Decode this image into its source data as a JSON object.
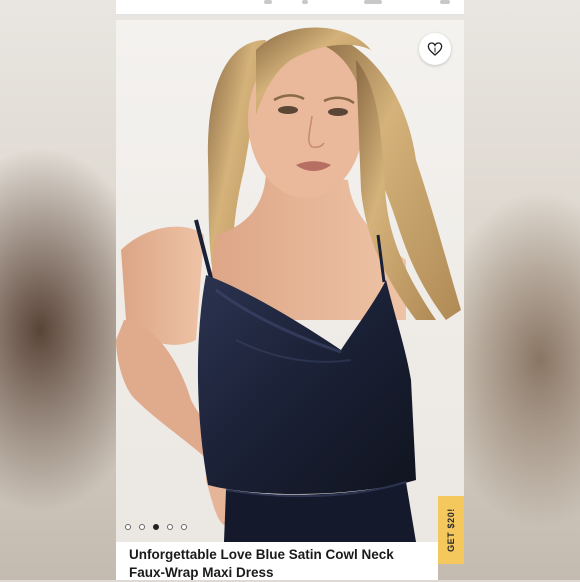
{
  "product": {
    "title": "Unforgettable Love Blue Satin Cowl Neck Faux-Wrap Maxi Dress"
  },
  "gallery": {
    "image_count": 5,
    "active_index": 2,
    "favorite_icon": "heart-icon"
  },
  "promo": {
    "label": "GET $20!",
    "color": "#f5c85d"
  },
  "colors": {
    "dress": "#1c2236",
    "hair": "#c9a36b",
    "skin": "#e8b89b"
  }
}
